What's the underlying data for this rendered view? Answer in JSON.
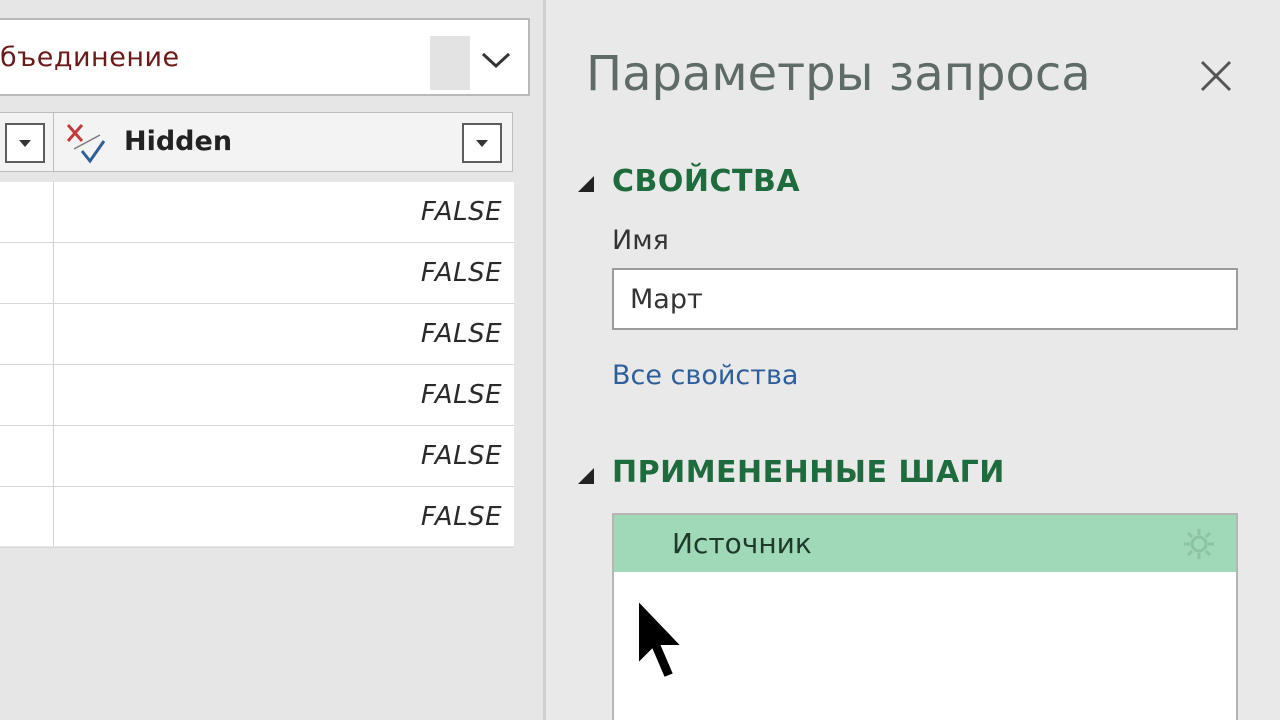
{
  "formula_bar": {
    "text": "бъединение",
    "dropdown_icon": "chevron-down-icon"
  },
  "table": {
    "column_hidden": {
      "title": "Hidden",
      "type_icon": "any-type-icon",
      "filter_icon": "dropdown-arrow-icon"
    },
    "rows": [
      {
        "hidden": "FALSE"
      },
      {
        "hidden": "FALSE"
      },
      {
        "hidden": "FALSE"
      },
      {
        "hidden": "FALSE"
      },
      {
        "hidden": "FALSE"
      },
      {
        "hidden": "FALSE"
      }
    ]
  },
  "query_settings": {
    "title": "Параметры запроса",
    "close_icon": "close-icon",
    "properties": {
      "title": "СВОЙСТВА",
      "name_label": "Имя",
      "name_value": "Март",
      "all_properties_link": "Все свойства"
    },
    "applied_steps": {
      "title": "ПРИМЕНЕННЫЕ ШАГИ",
      "steps": [
        {
          "label": "Источник",
          "icon": "gear-icon"
        }
      ]
    }
  },
  "colors": {
    "section_title": "#1e6b3d",
    "link": "#2e5f9a",
    "selected_step": "#9fd9b8",
    "formula_text": "#6b1a1a"
  }
}
